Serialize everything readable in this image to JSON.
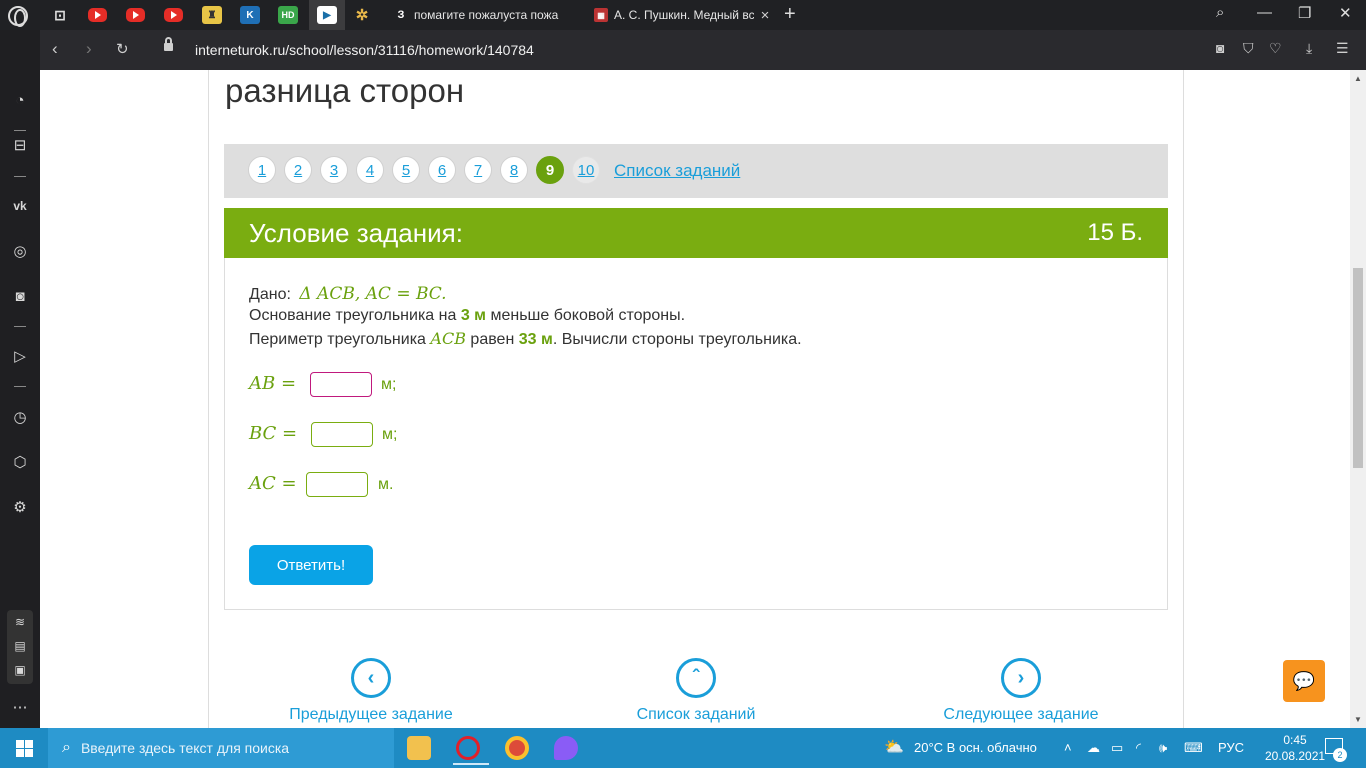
{
  "browser": {
    "tabs": [
      {
        "label": "помагите пожалуста пожа",
        "favicon": "З"
      },
      {
        "label": "А. С. Пушкин. Медный вса",
        "favicon": "theater-icon"
      }
    ],
    "url": "interneturok.ru/school/lesson/31116/homework/140784"
  },
  "page": {
    "title": "разница сторон",
    "pager": {
      "numbers": [
        "1",
        "2",
        "3",
        "4",
        "5",
        "6",
        "7",
        "8",
        "9",
        "10"
      ],
      "active": "9",
      "list_link": "Список заданий"
    },
    "task": {
      "header": "Условие задания:",
      "points": "15 Б.",
      "given_label": "Дано:",
      "given_math": "Δ ACB, AC = BC.",
      "line2_a": "Основание треугольника на",
      "line2_val": "3 м",
      "line2_b": "меньше боковой стороны.",
      "line3_a": "Периметр треугольника",
      "line3_math": "ACB",
      "line3_b": "равен",
      "line3_val": "33 м",
      "line3_c": ". Вычисли стороны треугольника.",
      "answers": [
        {
          "label": "AB =",
          "unit": "м;",
          "value": ""
        },
        {
          "label": "BC =",
          "unit": "м;",
          "value": ""
        },
        {
          "label": "AC =",
          "unit": "м.",
          "value": ""
        }
      ],
      "submit": "Ответить!"
    },
    "bottom_nav": {
      "prev": "Предыдущее задание",
      "list": "Список заданий",
      "next": "Следующее задание"
    }
  },
  "taskbar": {
    "search_placeholder": "Введите здесь текст для поиска",
    "weather": "20°C  В осн. облачно",
    "lang": "РУС",
    "time": "0:45",
    "date": "20.08.2021",
    "notifications": "2"
  }
}
